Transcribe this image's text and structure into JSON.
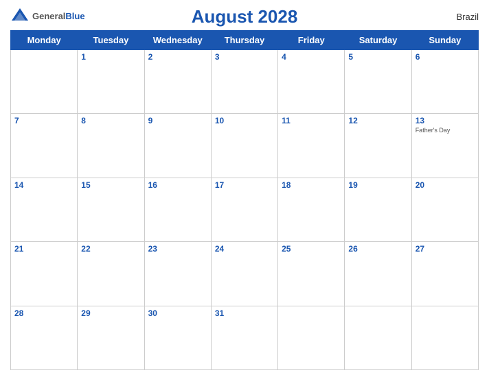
{
  "header": {
    "title": "August 2028",
    "country": "Brazil",
    "logo": {
      "general": "General",
      "blue": "Blue"
    }
  },
  "days_of_week": [
    "Monday",
    "Tuesday",
    "Wednesday",
    "Thursday",
    "Friday",
    "Saturday",
    "Sunday"
  ],
  "weeks": [
    [
      null,
      1,
      2,
      3,
      4,
      5,
      6
    ],
    [
      7,
      8,
      9,
      10,
      11,
      12,
      13
    ],
    [
      14,
      15,
      16,
      17,
      18,
      19,
      20
    ],
    [
      21,
      22,
      23,
      24,
      25,
      26,
      27
    ],
    [
      28,
      29,
      30,
      31,
      null,
      null,
      null
    ]
  ],
  "holidays": {
    "13": "Father's Day"
  }
}
